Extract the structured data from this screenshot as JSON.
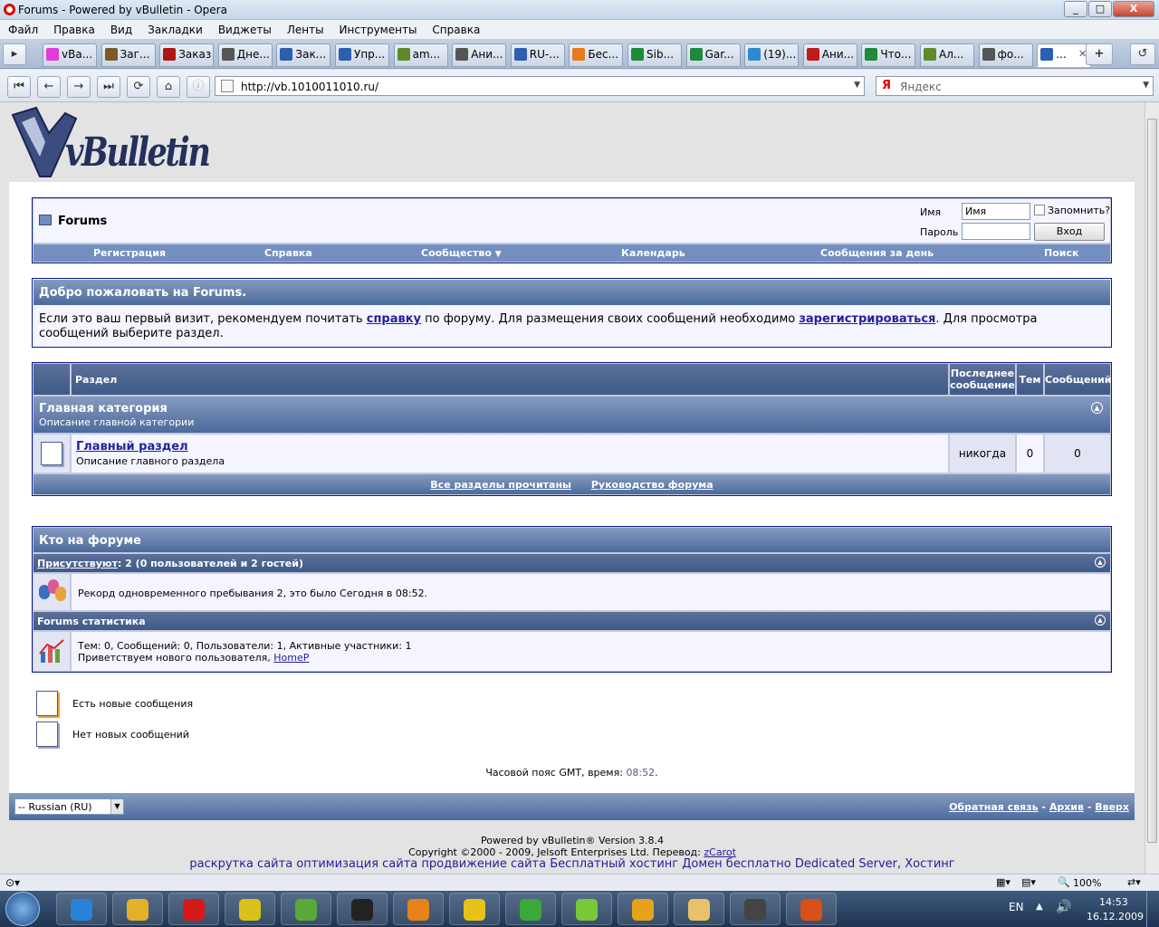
{
  "window": {
    "title": "Forums - Powered by vBulletin - Opera",
    "min": "_",
    "max": "□",
    "close": "X"
  },
  "menu": [
    "Файл",
    "Правка",
    "Вид",
    "Закладки",
    "Виджеты",
    "Ленты",
    "Инструменты",
    "Справка"
  ],
  "tabs": [
    {
      "label": "vBa...",
      "color": "#e23bd7"
    },
    {
      "label": "Заг...",
      "color": "#7a5a2a"
    },
    {
      "label": "Заказ",
      "color": "#b01515"
    },
    {
      "label": "Дне...",
      "color": "#555"
    },
    {
      "label": "Зак...",
      "color": "#2c5fb0"
    },
    {
      "label": "Упр...",
      "color": "#2c5fb0"
    },
    {
      "label": "am...",
      "color": "#5f8a2a"
    },
    {
      "label": "Ани...",
      "color": "#555"
    },
    {
      "label": "RU-...",
      "color": "#2c5fb0"
    },
    {
      "label": "Бес...",
      "color": "#e87a1a"
    },
    {
      "label": "Sib...",
      "color": "#1f8a3a"
    },
    {
      "label": "Gar...",
      "color": "#1f8a3a"
    },
    {
      "label": "(19)...",
      "color": "#2c8ad0"
    },
    {
      "label": "Ани...",
      "color": "#c01a1a"
    },
    {
      "label": "Что...",
      "color": "#1f8a3a"
    },
    {
      "label": "Ал...",
      "color": "#5f8a2a"
    },
    {
      "label": "фо...",
      "color": "#555"
    },
    {
      "label": "...",
      "color": "#2c5fb0"
    }
  ],
  "nav": {
    "url": "http://vb.1010011010.ru/",
    "search_placeholder": "Яндекс",
    "search_logo": "Я"
  },
  "forum": {
    "logo_text": "vBulletin",
    "navbar_title": "Forums",
    "login": {
      "user_label": "Имя",
      "user_value": "Имя",
      "pass_label": "Пароль",
      "remember": "Запомнить?",
      "submit": "Вход"
    },
    "links": [
      "Регистрация",
      "Справка",
      "Сообщество",
      "Календарь",
      "Сообщения за день",
      "Поиск"
    ],
    "welcome": {
      "title": "Добро пожаловать на Forums.",
      "t1": "Если это ваш первый визит, рекомендуем почитать ",
      "l1": "справку",
      "t2": " по форуму. Для размещения своих сообщений необходимо ",
      "l2": "зарегистрироваться",
      "t3": ". Для просмотра сообщений выберите раздел."
    },
    "table": {
      "col_section": "Раздел",
      "col_last1": "Последнее",
      "col_last2": "сообщение",
      "col_threads": "Тем",
      "col_posts": "Сообщений",
      "category": {
        "title": "Главная категория",
        "desc": "Описание главной категории"
      },
      "row": {
        "title": "Главный раздел",
        "desc": "Описание главного раздела",
        "last": "никогда",
        "threads": "0",
        "posts": "0"
      },
      "foot1": "Все разделы прочитаны",
      "foot2": "Руководство форума"
    },
    "who": {
      "title": "Кто на форуме",
      "present_link": "Присутствуют",
      "present_text": ": 2 (0 пользователей и 2 гостей)",
      "record": "Рекорд одновременного пребывания 2, это было Сегодня в 08:52.",
      "stats_title": "Forums статистика",
      "stats_line": "Тем: 0, Сообщений: 0, Пользователи: 1, Активные участники: 1",
      "welcome_text": "Приветствуем нового пользователя, ",
      "welcome_user": "HomeP"
    },
    "legend": {
      "new": "Есть новые сообщения",
      "old": "Нет новых сообщений"
    },
    "tz": {
      "text": "Часовой пояс GMT, время: ",
      "time": "08:52",
      "dot": "."
    },
    "footer": {
      "lang": "-- Russian (RU)",
      "feedback": "Обратная связь",
      "sep": " - ",
      "archive": "Архив",
      "top": "Вверх"
    },
    "powered": {
      "line1": "Powered by vBulletin® Version 3.8.4",
      "line2": "Copyright ©2000 - 2009, Jelsoft Enterprises Ltd. Перевод: ",
      "translator": "zCarot",
      "ads": "раскрутка сайта оптимизация сайта продвижение сайта Бесплатный хостинг Домен бесплатно Dedicated Server, Хостинг"
    }
  },
  "status": {
    "zoom": "100%"
  },
  "taskbar": {
    "icons": [
      {
        "name": "ie-icon",
        "color": "#2a82d8"
      },
      {
        "name": "chrome-icon",
        "color": "#e2b12a"
      },
      {
        "name": "opera-icon",
        "color": "#d61a1a"
      },
      {
        "name": "1c-icon",
        "color": "#d8c21a"
      },
      {
        "name": "fastfolder-icon",
        "color": "#5aa83a"
      },
      {
        "name": "steam-icon",
        "color": "#222"
      },
      {
        "name": "media-player-icon",
        "color": "#e8821a"
      },
      {
        "name": "emulator-icon",
        "color": "#e8c21a"
      },
      {
        "name": "utorrent-icon",
        "color": "#3aa83a"
      },
      {
        "name": "chemistry-icon",
        "color": "#7ac83a"
      },
      {
        "name": "winamp-icon",
        "color": "#e8a21a"
      },
      {
        "name": "explorer-icon",
        "color": "#e8c26a"
      },
      {
        "name": "video-321-icon",
        "color": "#444"
      },
      {
        "name": "halflife-icon",
        "color": "#d8501a"
      }
    ],
    "lang": "EN",
    "time": "14:53",
    "date": "16.12.2009"
  }
}
